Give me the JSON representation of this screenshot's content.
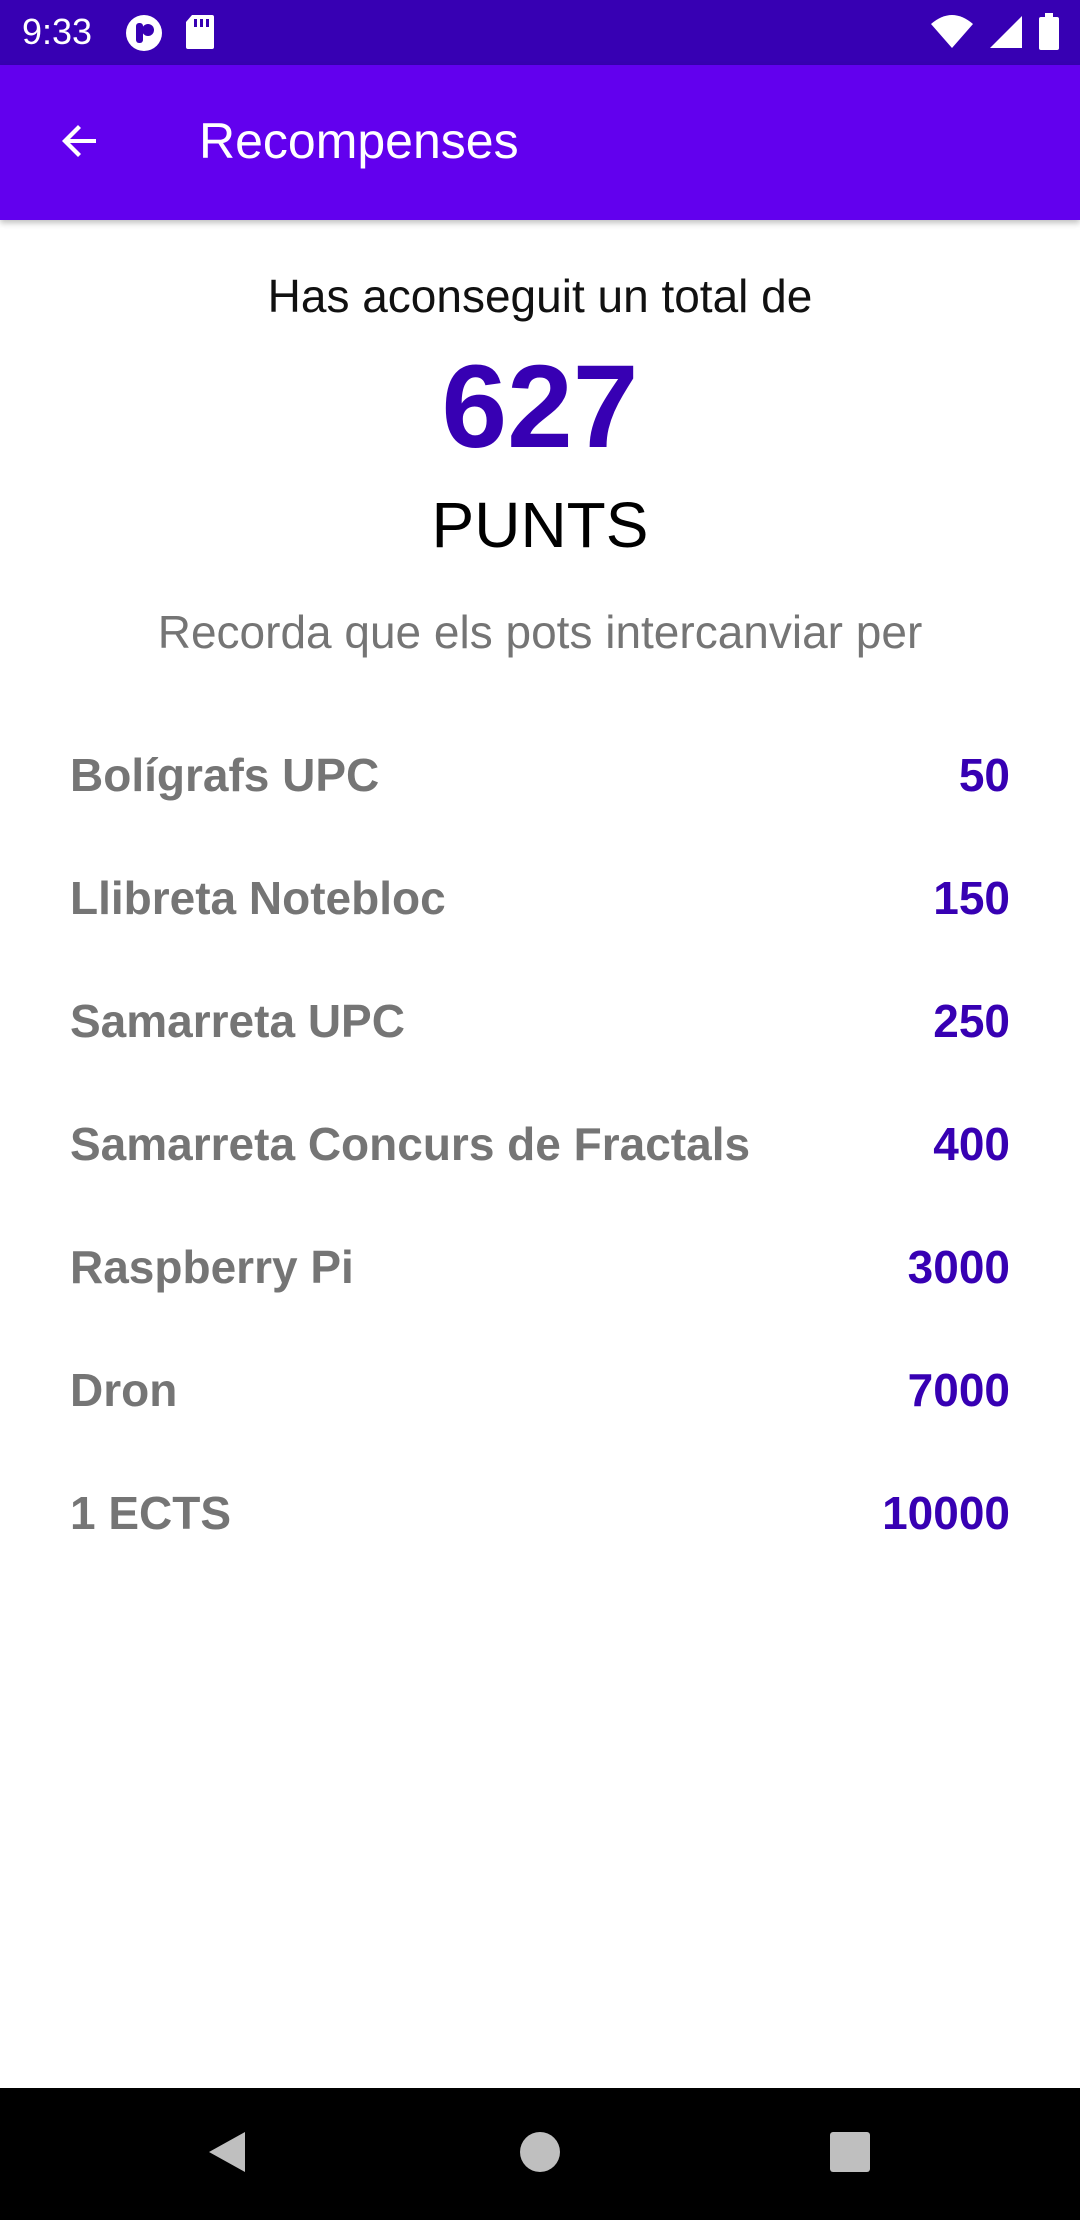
{
  "status_bar": {
    "time": "9:33",
    "left_icons": [
      "app-notification-icon",
      "sd-card-icon"
    ],
    "right_icons": [
      "wifi-icon",
      "cell-signal-icon",
      "battery-icon"
    ]
  },
  "app_bar": {
    "title": "Recompenses",
    "back_icon": "arrow-back-icon"
  },
  "summary": {
    "intro": "Has aconseguit un total de",
    "points": "627",
    "unit": "PUNTS",
    "reminder": "Recorda que els pots intercanviar per"
  },
  "rewards": [
    {
      "name": "Bolígrafs UPC",
      "cost": "50"
    },
    {
      "name": "Llibreta Notebloc",
      "cost": "150"
    },
    {
      "name": "Samarreta UPC",
      "cost": "250"
    },
    {
      "name": "Samarreta Concurs de Fractals",
      "cost": "400"
    },
    {
      "name": "Raspberry Pi",
      "cost": "3000"
    },
    {
      "name": "Dron",
      "cost": "7000"
    },
    {
      "name": "1 ECTS",
      "cost": "10000"
    }
  ],
  "nav_bar": {
    "icons": [
      "nav-back-icon",
      "nav-home-icon",
      "nav-recents-icon"
    ]
  },
  "colors": {
    "status_bar": "#3700b3",
    "app_bar": "#6200ee",
    "accent": "#3700b3",
    "secondary_text": "#757575"
  }
}
